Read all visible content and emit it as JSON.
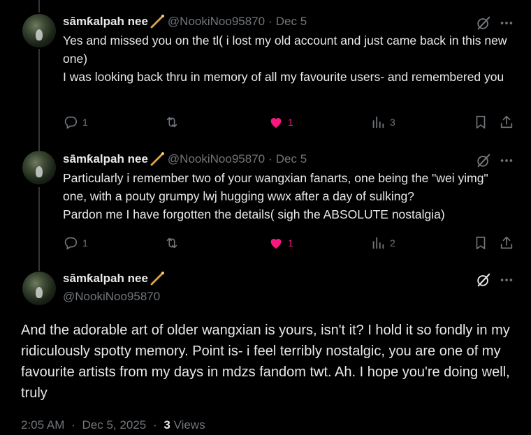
{
  "tweets": [
    {
      "name": "sāmƙalpah nee",
      "handle": "@NookiNoo95870",
      "separator": "·",
      "date": "Dec 5",
      "text": "Yes and missed you on the tl( i lost my old account and just came back in this new one)\nI was looking back thru in memory of all my favourite users- and remembered you",
      "replies": "1",
      "likes": "1",
      "views": "3"
    },
    {
      "name": "sāmƙalpah nee",
      "handle": "@NookiNoo95870",
      "separator": "·",
      "date": "Dec 5",
      "text": "Particularly i remember two of your wangxian fanarts, one being the \"wei yimg\" one, with a pouty grumpy lwj hugging wwx after a day of sulking?\nPardon me I have forgotten the details( sigh the ABSOLUTE nostalgia)",
      "replies": "1",
      "likes": "1",
      "views": "2"
    }
  ],
  "main": {
    "name": "sāmƙalpah nee",
    "handle": "@NookiNoo95870",
    "text": "And the adorable art of older wangxian is yours, isn't it? I hold it so fondly in my ridiculously spotty memory. Point is- i feel terribly nostalgic, you are one of my favourite artists from my days in mdzs fandom twt. Ah. I hope you're doing well, truly",
    "time": "2:05 AM",
    "date": "Dec 5, 2025",
    "separator": "·",
    "views_count": "3",
    "views_label": "Views"
  },
  "colors": {
    "text": "#e7e9ea",
    "muted": "#71767b",
    "like": "#f91880",
    "background": "#000000"
  },
  "icons": [
    "wand-emoji-icon",
    "grok-icon",
    "more-icon",
    "reply-icon",
    "retweet-icon",
    "like-icon",
    "views-icon",
    "bookmark-icon",
    "share-icon"
  ]
}
